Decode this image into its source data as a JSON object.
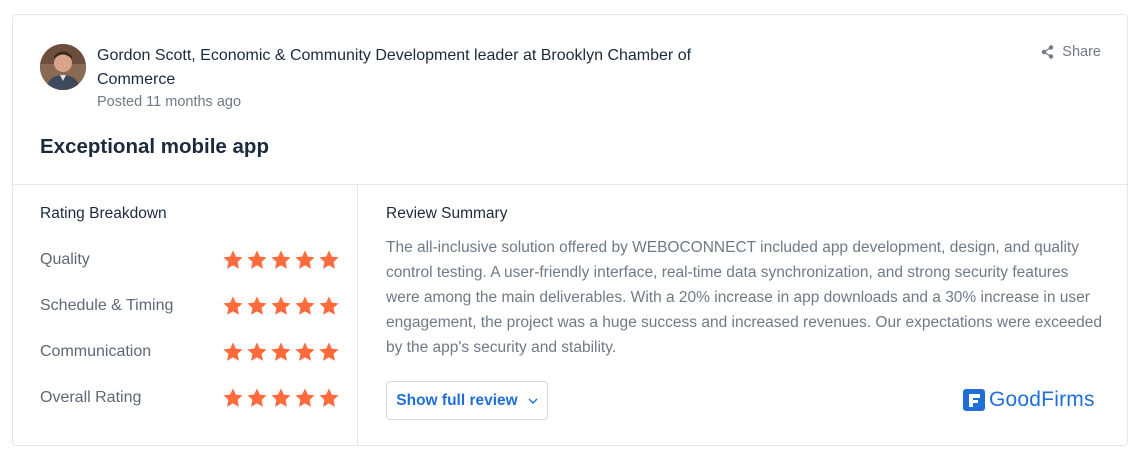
{
  "review": {
    "author": "Gordon Scott, Economic & Community Development leader at Brooklyn Chamber of Commerce",
    "posted": "Posted 11 months ago",
    "share_label": "Share",
    "title": "Exceptional mobile app"
  },
  "ratings": {
    "heading": "Rating Breakdown",
    "star_color": "#ff6b3d",
    "items": [
      {
        "label": "Quality",
        "stars": 5
      },
      {
        "label": "Schedule & Timing",
        "stars": 5
      },
      {
        "label": "Communication",
        "stars": 5
      },
      {
        "label": "Overall Rating",
        "stars": 5
      }
    ]
  },
  "summary": {
    "heading": "Review Summary",
    "text": "The all-inclusive solution offered by WEBOCONNECT included app development, design, and quality control testing. A user-friendly interface, real-time data synchronization, and strong security features were among the main deliverables. With a 20% increase in app downloads and a 30% increase in user engagement, the project was a huge success and increased revenues. Our expectations were exceeded by the app's security and stability.",
    "show_full_label": "Show full review"
  },
  "brand": {
    "name": "GoodFirms",
    "color": "#1f6fd6"
  },
  "icons": [
    "avatar",
    "share-icon",
    "star-icon",
    "chevron-down-icon",
    "goodfirms-logo-icon"
  ]
}
